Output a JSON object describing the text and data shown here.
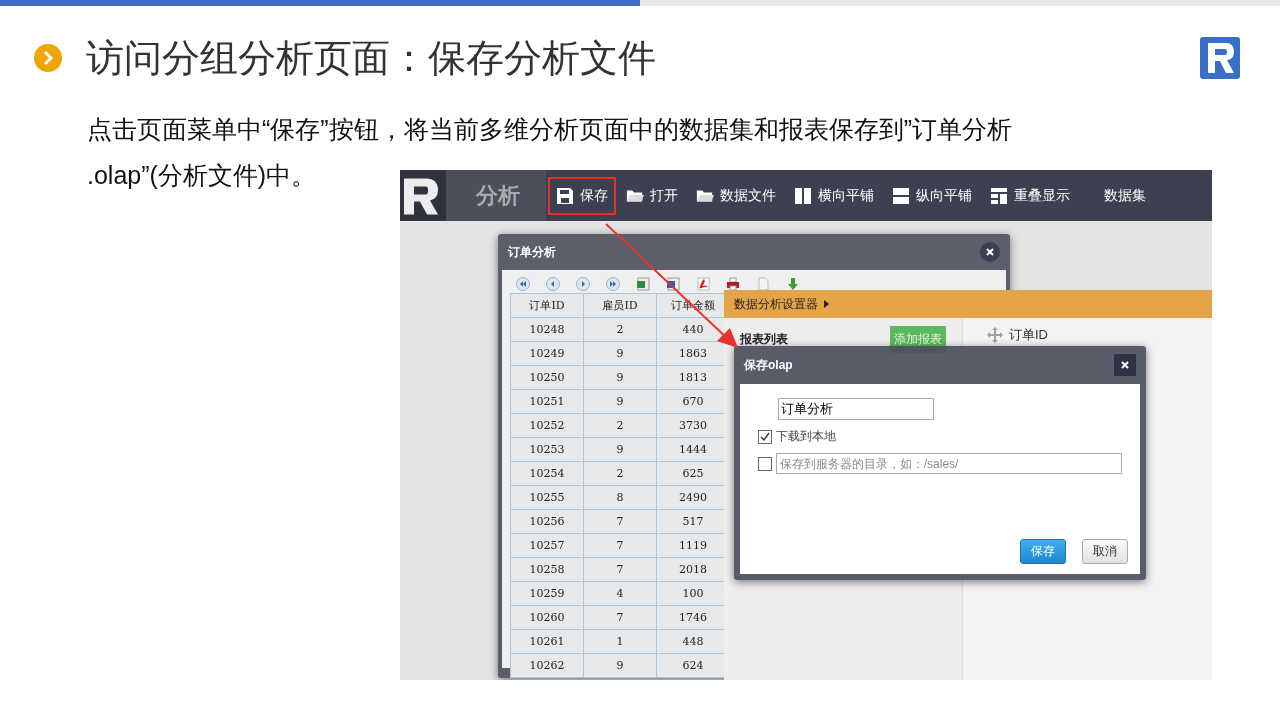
{
  "slide": {
    "title": "访问分组分析页面：保存分析文件",
    "body_lines": [
      "点击页面菜单中“保存”按钮，将当前多维分析页面中的数据集和报表保存到”订单分析",
      ".olap”(分析文件)中。"
    ]
  },
  "app": {
    "brand": "分析",
    "menu": [
      {
        "label": "保存",
        "kind": "save",
        "highlighted": true
      },
      {
        "label": "打开",
        "kind": "folder",
        "highlighted": false
      },
      {
        "label": "数据文件",
        "kind": "folder",
        "highlighted": false
      },
      {
        "label": "横向平铺",
        "kind": "columns",
        "highlighted": false
      },
      {
        "label": "纵向平铺",
        "kind": "rows",
        "highlighted": false
      },
      {
        "label": "重叠显示",
        "kind": "stack",
        "highlighted": false
      },
      {
        "label": "数据集",
        "kind": "text",
        "highlighted": false
      }
    ]
  },
  "report_window": {
    "title": "订单分析",
    "table": {
      "columns": [
        "订单ID",
        "雇员ID",
        "订单金额"
      ],
      "rows": [
        [
          "10248",
          "2",
          "440"
        ],
        [
          "10249",
          "9",
          "1863"
        ],
        [
          "10250",
          "9",
          "1813"
        ],
        [
          "10251",
          "9",
          "670"
        ],
        [
          "10252",
          "2",
          "3730"
        ],
        [
          "10253",
          "9",
          "1444"
        ],
        [
          "10254",
          "2",
          "625"
        ],
        [
          "10255",
          "8",
          "2490"
        ],
        [
          "10256",
          "7",
          "517"
        ],
        [
          "10257",
          "7",
          "1119"
        ],
        [
          "10258",
          "7",
          "2018"
        ],
        [
          "10259",
          "4",
          "100"
        ],
        [
          "10260",
          "7",
          "1746"
        ],
        [
          "10261",
          "1",
          "448"
        ],
        [
          "10262",
          "9",
          "624"
        ]
      ]
    }
  },
  "settings": {
    "title": "数据分析设置器",
    "report_list_label": "报表列表",
    "add_button": "添加报表",
    "fields": [
      "订单ID"
    ]
  },
  "dialog": {
    "title": "保存olap",
    "name_value": "订单分析",
    "options": [
      {
        "kind": "label",
        "checked": true,
        "label": "下载到本地"
      },
      {
        "kind": "path",
        "checked": false,
        "placeholder": "保存到服务器的目录，如：/sales/"
      }
    ],
    "buttons": [
      {
        "label": "保存",
        "primary": true
      },
      {
        "label": "取消",
        "primary": false
      }
    ]
  }
}
